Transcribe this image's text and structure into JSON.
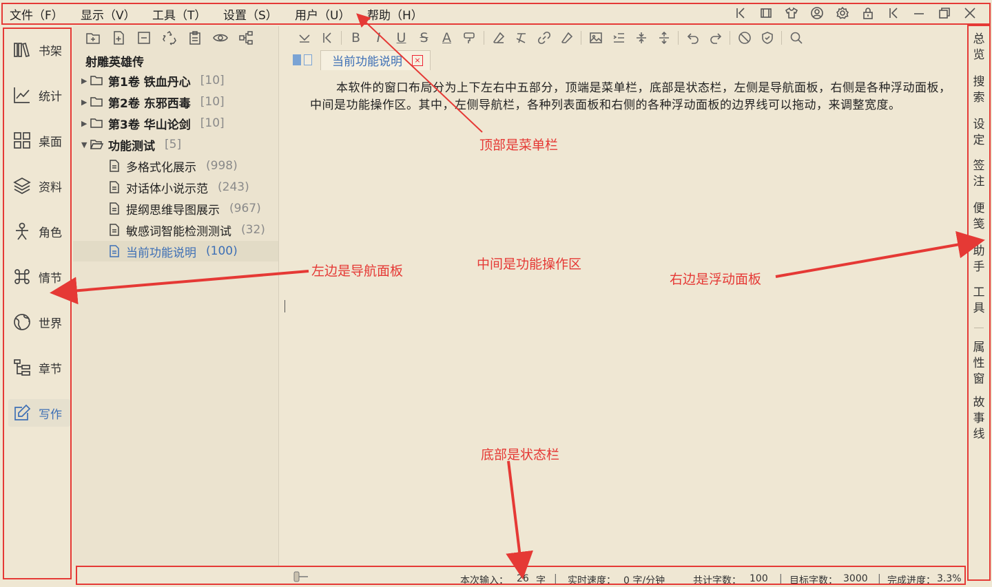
{
  "menu": {
    "items": [
      "文件（F）",
      "显示（V）",
      "工具（T）",
      "设置（S）",
      "用户（U）",
      "帮助（H）"
    ]
  },
  "window_controls": [
    "collapse-icon",
    "fullscreen-icon",
    "theme-icon",
    "user-icon",
    "settings-icon",
    "lock-icon",
    "collapse-icon",
    "minimize-icon",
    "restore-icon",
    "close-icon"
  ],
  "nav": {
    "items": [
      {
        "label": "书架",
        "icon": "bookshelf-icon"
      },
      {
        "label": "统计",
        "icon": "chart-icon"
      },
      {
        "label": "桌面",
        "icon": "grid-icon"
      },
      {
        "label": "资料",
        "icon": "layers-icon"
      },
      {
        "label": "角色",
        "icon": "person-icon"
      },
      {
        "label": "情节",
        "icon": "command-icon"
      },
      {
        "label": "世界",
        "icon": "globe-icon"
      },
      {
        "label": "章节",
        "icon": "tree-icon"
      },
      {
        "label": "写作",
        "icon": "edit-icon"
      }
    ],
    "active": "写作"
  },
  "tree": {
    "book_title": "射雕英雄传",
    "volumes": [
      {
        "name": "第1卷 铁血丹心",
        "count": "[10]"
      },
      {
        "name": "第2卷 东邪西毒",
        "count": "[10]"
      },
      {
        "name": "第3卷 华山论剑",
        "count": "[10]"
      },
      {
        "name": "功能测试",
        "count": "[5]"
      }
    ],
    "docs": [
      {
        "name": "多格式化展示",
        "count": "(998)"
      },
      {
        "name": "对话体小说示范",
        "count": "(243)"
      },
      {
        "name": "提纲思维导图展示",
        "count": "(967)"
      },
      {
        "name": "敏感词智能检测测试",
        "count": "(32)"
      },
      {
        "name": "当前功能说明",
        "count": "(100)"
      }
    ]
  },
  "editor": {
    "tab_title": "当前功能说明",
    "tab_close": "×",
    "content": "本软件的窗口布局分为上下左右中五部分，顶端是菜单栏，底部是状态栏，左侧是导航面板，右侧是各种浮动面板，中间是功能操作区。其中，左侧导航栏，各种列表面板和右侧的各种浮动面板的边界线可以拖动，来调整宽度。"
  },
  "right_panel": {
    "tabs": [
      "总览",
      "搜索",
      "设定",
      "签注",
      "便笺",
      "助手",
      "工具",
      "属性窗",
      "故事线"
    ]
  },
  "status": {
    "input_label": "本次输入：",
    "input_value": "26",
    "input_unit": "字",
    "speed_label": "实时速度：",
    "speed_value": "0 字/分钟",
    "total_label": "共计字数：",
    "total_value": "100",
    "target_label": "目标字数：",
    "target_value": "3000",
    "progress_label": "完成进度：",
    "progress_value": "3.3%"
  },
  "annotations": {
    "menubar": "顶部是菜单栏",
    "leftnav": "左边是导航面板",
    "center": "中间是功能操作区",
    "right": "右边是浮动面板",
    "statusbar": "底部是状态栏"
  },
  "colors": {
    "background": "#efe7d3",
    "accent_blue": "#3d6fb5",
    "annotation_red": "#e53935"
  }
}
